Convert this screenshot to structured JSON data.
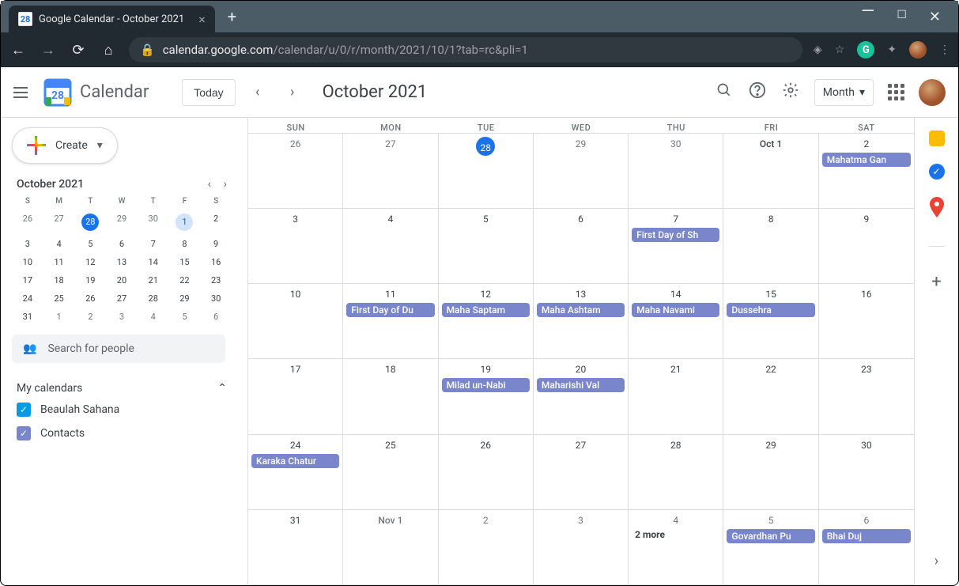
{
  "browser": {
    "tab_title": "Google Calendar - October 2021",
    "favicon_text": "28",
    "url_host": "calendar.google.com",
    "url_path": "/calendar/u/0/r/month/2021/10/1?tab=rc&pli=1"
  },
  "header": {
    "app_name": "Calendar",
    "logo_day": "28",
    "today_label": "Today",
    "month_title": "October 2021",
    "view_label": "Month"
  },
  "create_label": "Create",
  "mini": {
    "title": "October 2021",
    "dow": [
      "S",
      "M",
      "T",
      "W",
      "T",
      "F",
      "S"
    ],
    "rows": [
      [
        {
          "d": "26",
          "o": true
        },
        {
          "d": "27",
          "o": true
        },
        {
          "d": "28",
          "o": true,
          "sel": true
        },
        {
          "d": "29",
          "o": true
        },
        {
          "d": "30",
          "o": true
        },
        {
          "d": "1",
          "today": true
        },
        {
          "d": "2"
        }
      ],
      [
        {
          "d": "3"
        },
        {
          "d": "4"
        },
        {
          "d": "5"
        },
        {
          "d": "6"
        },
        {
          "d": "7"
        },
        {
          "d": "8"
        },
        {
          "d": "9"
        }
      ],
      [
        {
          "d": "10"
        },
        {
          "d": "11"
        },
        {
          "d": "12"
        },
        {
          "d": "13"
        },
        {
          "d": "14"
        },
        {
          "d": "15"
        },
        {
          "d": "16"
        }
      ],
      [
        {
          "d": "17"
        },
        {
          "d": "18"
        },
        {
          "d": "19"
        },
        {
          "d": "20"
        },
        {
          "d": "21"
        },
        {
          "d": "22"
        },
        {
          "d": "23"
        }
      ],
      [
        {
          "d": "24"
        },
        {
          "d": "25"
        },
        {
          "d": "26"
        },
        {
          "d": "27"
        },
        {
          "d": "28"
        },
        {
          "d": "29"
        },
        {
          "d": "30"
        }
      ],
      [
        {
          "d": "31"
        },
        {
          "d": "1",
          "o": true
        },
        {
          "d": "2",
          "o": true
        },
        {
          "d": "3",
          "o": true
        },
        {
          "d": "4",
          "o": true
        },
        {
          "d": "5",
          "o": true
        },
        {
          "d": "6",
          "o": true
        }
      ]
    ]
  },
  "search_people_placeholder": "Search for people",
  "my_calendars_label": "My calendars",
  "calendars": [
    {
      "name": "Beaulah Sahana",
      "color": "#039be5"
    },
    {
      "name": "Contacts",
      "color": "#7986cb"
    }
  ],
  "grid": {
    "dow": [
      "SUN",
      "MON",
      "TUE",
      "WED",
      "THU",
      "FRI",
      "SAT"
    ],
    "weeks": [
      [
        {
          "n": "26",
          "other": true
        },
        {
          "n": "27",
          "other": true
        },
        {
          "n": "28",
          "other": true,
          "today": true
        },
        {
          "n": "29",
          "other": true
        },
        {
          "n": "30",
          "other": true
        },
        {
          "n": "Oct 1",
          "first": true
        },
        {
          "n": "2",
          "events": [
            "Mahatma Gan"
          ]
        }
      ],
      [
        {
          "n": "3"
        },
        {
          "n": "4"
        },
        {
          "n": "5"
        },
        {
          "n": "6"
        },
        {
          "n": "7",
          "events": [
            "First Day of Sh"
          ]
        },
        {
          "n": "8"
        },
        {
          "n": "9"
        }
      ],
      [
        {
          "n": "10"
        },
        {
          "n": "11",
          "events": [
            "First Day of Du"
          ]
        },
        {
          "n": "12",
          "events": [
            "Maha Saptam"
          ]
        },
        {
          "n": "13",
          "events": [
            "Maha Ashtam"
          ]
        },
        {
          "n": "14",
          "events": [
            "Maha Navami"
          ]
        },
        {
          "n": "15",
          "events": [
            "Dussehra"
          ]
        },
        {
          "n": "16"
        }
      ],
      [
        {
          "n": "17"
        },
        {
          "n": "18"
        },
        {
          "n": "19",
          "events": [
            "Milad un-Nabi"
          ]
        },
        {
          "n": "20",
          "events": [
            "Maharishi Val"
          ]
        },
        {
          "n": "21"
        },
        {
          "n": "22"
        },
        {
          "n": "23"
        }
      ],
      [
        {
          "n": "24",
          "events": [
            "Karaka Chatur"
          ]
        },
        {
          "n": "25"
        },
        {
          "n": "26"
        },
        {
          "n": "27"
        },
        {
          "n": "28"
        },
        {
          "n": "29"
        },
        {
          "n": "30"
        }
      ],
      [
        {
          "n": "31"
        },
        {
          "n": "Nov 1",
          "other": true,
          "first": true
        },
        {
          "n": "2",
          "other": true
        },
        {
          "n": "3",
          "other": true
        },
        {
          "n": "4",
          "other": true,
          "more": "2 more"
        },
        {
          "n": "5",
          "other": true,
          "events": [
            "Govardhan Pu"
          ]
        },
        {
          "n": "6",
          "other": true,
          "events": [
            "Bhai Duj"
          ]
        }
      ]
    ]
  }
}
